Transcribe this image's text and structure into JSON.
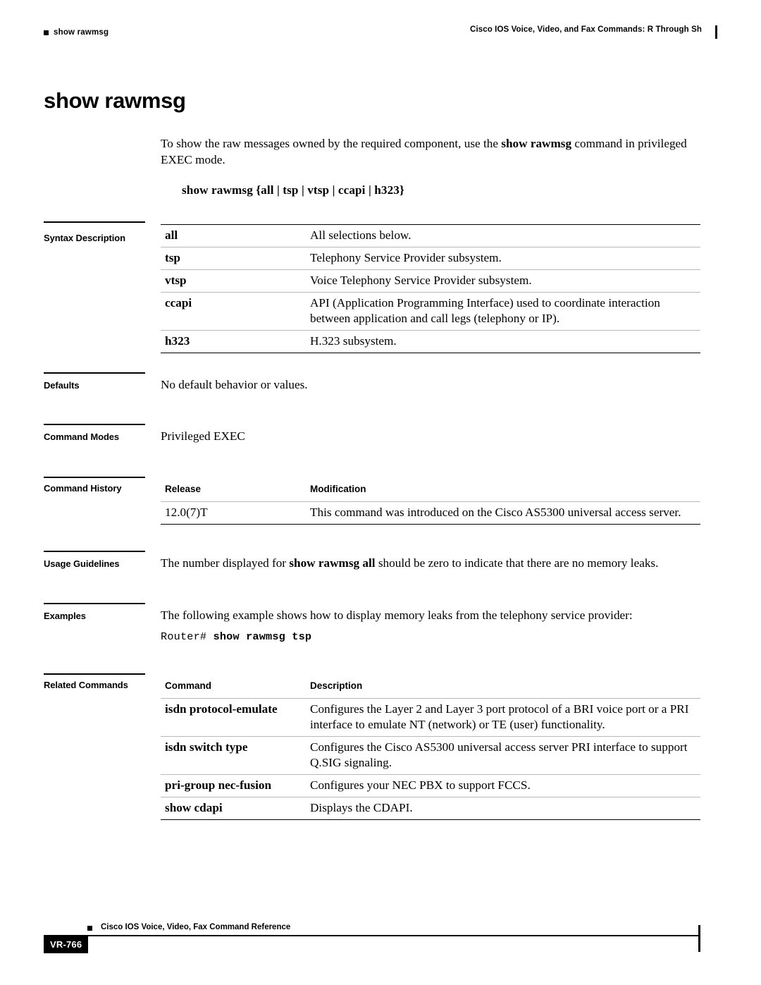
{
  "header": {
    "running_head_left": "show rawmsg",
    "running_head_right": "Cisco IOS Voice, Video, and Fax Commands: R Through Sh"
  },
  "title": "show rawmsg",
  "intro": {
    "text_before_bold": "To show the raw messages owned by the required component, use the ",
    "bold": "show rawmsg",
    "text_after_bold": " command in privileged EXEC mode.",
    "syntax": "show rawmsg {all | tsp | vtsp | ccapi | h323}"
  },
  "sections": {
    "syntax_description": {
      "label": "Syntax Description",
      "rows": [
        {
          "term": "all",
          "desc": "All selections below."
        },
        {
          "term": "tsp",
          "desc": "Telephony Service Provider subsystem."
        },
        {
          "term": "vtsp",
          "desc": "Voice Telephony Service Provider subsystem."
        },
        {
          "term": "ccapi",
          "desc": "API (Application Programming Interface) used to coordinate interaction between application and call legs (telephony or IP)."
        },
        {
          "term": "h323",
          "desc": "H.323 subsystem."
        }
      ]
    },
    "defaults": {
      "label": "Defaults",
      "text": "No default behavior or values."
    },
    "command_modes": {
      "label": "Command Modes",
      "text": "Privileged EXEC"
    },
    "command_history": {
      "label": "Command History",
      "headers": {
        "release": "Release",
        "modification": "Modification"
      },
      "rows": [
        {
          "release": "12.0(7)T",
          "modification": "This command was introduced on the Cisco AS5300 universal access server."
        }
      ]
    },
    "usage_guidelines": {
      "label": "Usage Guidelines",
      "text_before_bold": "The number displayed for ",
      "bold": "show rawmsg all",
      "text_after_bold": " should be zero to indicate that there are no memory leaks."
    },
    "examples": {
      "label": "Examples",
      "text": "The following example shows how to display memory leaks from the telephony service provider:",
      "code_prompt": "Router# ",
      "code_command": "show rawmsg tsp"
    },
    "related_commands": {
      "label": "Related Commands",
      "headers": {
        "command": "Command",
        "description": "Description"
      },
      "rows": [
        {
          "command": "isdn protocol-emulate",
          "description": "Configures the Layer 2 and Layer 3 port protocol of a BRI voice port or a PRI interface to emulate NT (network) or TE (user) functionality."
        },
        {
          "command": "isdn switch type",
          "description": "Configures the Cisco AS5300 universal access server PRI interface to support Q.SIG signaling."
        },
        {
          "command": "pri-group nec-fusion",
          "description": "Configures your NEC PBX to support FCCS."
        },
        {
          "command": "show cdapi",
          "description": "Displays the CDAPI."
        }
      ]
    }
  },
  "footer": {
    "doc_title": "Cisco IOS Voice, Video, Fax Command Reference",
    "page_number": "VR-766"
  }
}
